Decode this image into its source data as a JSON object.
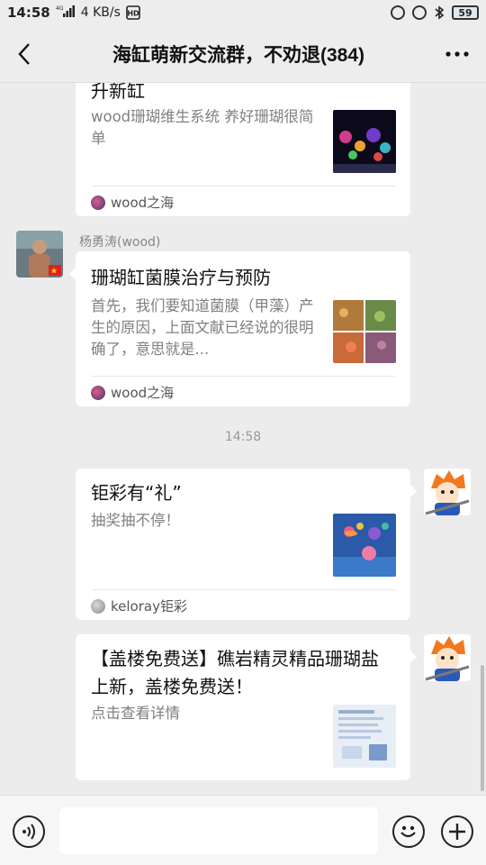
{
  "status_bar": {
    "time": "14:58",
    "network_label": "4G",
    "speed": "4 KB/s",
    "hd_label": "HD",
    "battery": "59"
  },
  "header": {
    "title": "海缸萌新交流群，不劝退(384)"
  },
  "messages": [
    {
      "title": "升新缸",
      "description": "wood珊瑚维生系统 养好珊瑚很简单",
      "source": "wood之海",
      "icon": "coral-tank-thumbnail"
    },
    {
      "sender": "杨勇涛(wood)",
      "title": "珊瑚缸菌膜治疗与预防",
      "description": "首先，我们要知道菌膜（甲藻）产生的原因，上面文献已经说的很明确了，意思就是...",
      "source": "wood之海",
      "icon": "coral-grid-thumbnail"
    },
    {
      "timestamp": "14:58"
    },
    {
      "title": "钜彩有“礼”",
      "description": "抽奖抽不停！",
      "source": "keloray钜彩",
      "icon": "reef-illustration-thumbnail"
    },
    {
      "title": "【盖楼免费送】礁岩精灵精品珊瑚盐上新，盖楼免费送！",
      "description": "点击查看详情",
      "icon": "product-sheet-thumbnail"
    }
  ],
  "input": {
    "placeholder": ""
  },
  "colors": {
    "background": "#ececec",
    "bubble": "#ffffff",
    "secondary_text": "#808080"
  }
}
